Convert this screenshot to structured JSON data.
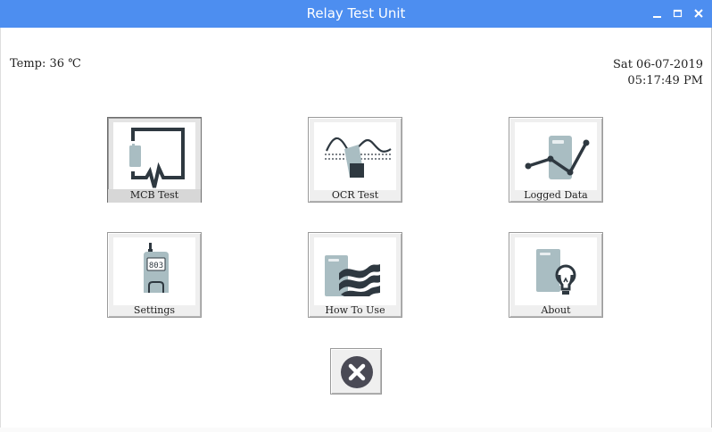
{
  "window": {
    "title": "Relay Test Unit",
    "controls": {
      "minimize": "minimize-icon",
      "maximize": "maximize-icon",
      "close": "close-icon"
    },
    "title_bar_color": "#4d8ef0"
  },
  "status": {
    "temperature": "Temp: 36 ℃",
    "date": "Sat 06-07-2019",
    "time": "05:17:49 PM"
  },
  "menu": [
    {
      "label": "MCB Test",
      "icon": "waveform-icon"
    },
    {
      "label": "OCR Test",
      "icon": "sine-wave-icon"
    },
    {
      "label": "Logged Data",
      "icon": "line-graph-icon"
    },
    {
      "label": "Settings",
      "icon": "handheld-device-icon",
      "device_display": "803"
    },
    {
      "label": "How To Use",
      "icon": "document-waves-icon"
    },
    {
      "label": "About",
      "icon": "lightbulb-icon"
    }
  ],
  "exit": {
    "icon": "close-circle-icon"
  },
  "colors": {
    "icon_dark": "#2e3840",
    "icon_light": "#a9bdc2"
  }
}
